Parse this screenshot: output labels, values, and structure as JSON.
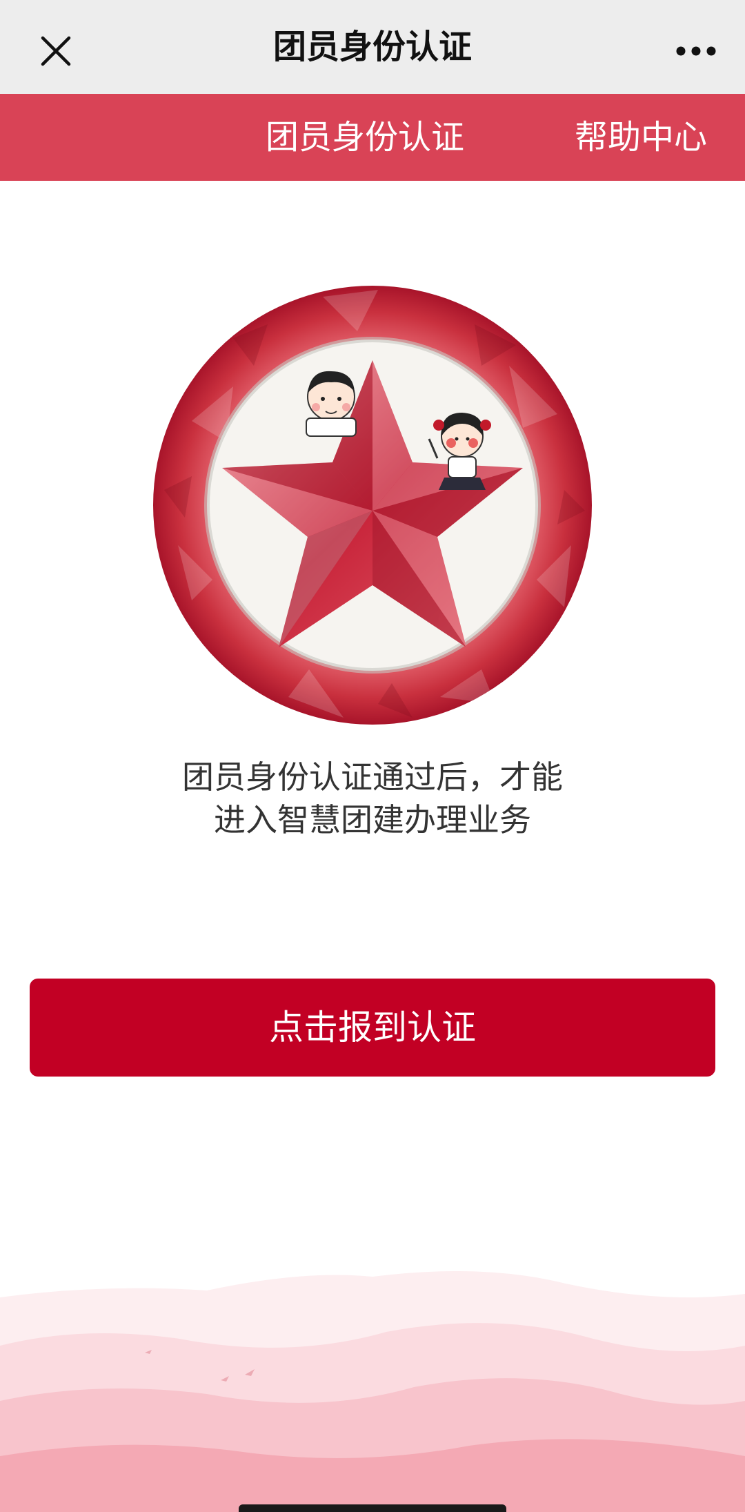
{
  "navbar": {
    "title": "团员身份认证",
    "close_icon": "close-icon",
    "more_icon": "more-dots-icon"
  },
  "tabs": [
    {
      "label": "团员身份认证"
    },
    {
      "label": "帮助中心"
    }
  ],
  "emblem": {
    "icon": "youth-league-star-emblem"
  },
  "description": {
    "line1": "团员身份认证通过后，才能",
    "line2": "进入智慧团建办理业务"
  },
  "button": {
    "label": "点击报到认证"
  },
  "colors": {
    "tab_bar": "#d94356",
    "button": "#c20024",
    "navbar": "#ededed",
    "text": "#333333"
  }
}
